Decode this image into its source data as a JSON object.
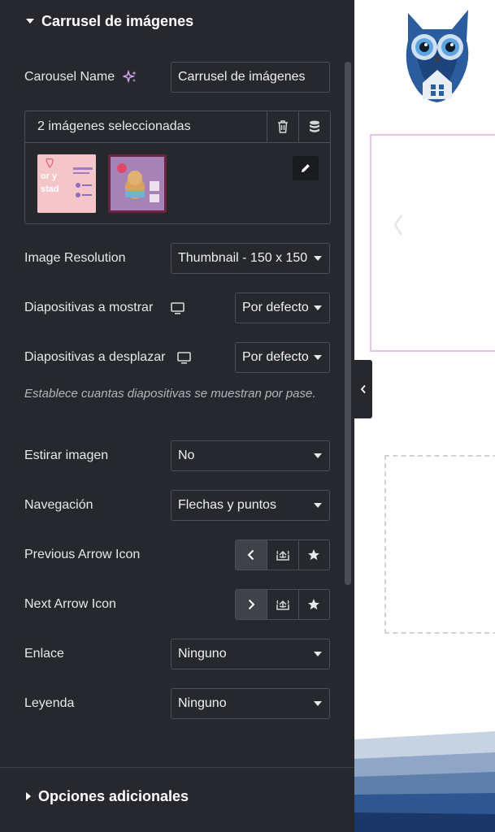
{
  "panel": {
    "section_title": "Carrusel de imágenes",
    "carousel_name": {
      "label": "Carousel Name",
      "value": "Carrusel de imágenes"
    },
    "gallery": {
      "count_text": "2 imágenes seleccionadas",
      "thumb1_text": "or y\nstad",
      "thumb2_text": ""
    },
    "image_resolution": {
      "label": "Image Resolution",
      "value": "Thumbnail - 150 x 150"
    },
    "slides_to_show": {
      "label": "Diapositivas a mostrar",
      "value": "Por defecto"
    },
    "slides_to_scroll": {
      "label": "Diapositivas a desplazar",
      "value": "Por defecto"
    },
    "help_text": "Establece cuantas diapositivas se muestran por pase.",
    "stretch_image": {
      "label": "Estirar imagen",
      "value": "No"
    },
    "navigation": {
      "label": "Navegación",
      "value": "Flechas y puntos"
    },
    "previous_arrow": {
      "label": "Previous Arrow Icon"
    },
    "next_arrow": {
      "label": "Next Arrow Icon"
    },
    "link": {
      "label": "Enlace",
      "value": "Ninguno"
    },
    "caption": {
      "label": "Leyenda",
      "value": "Ninguno"
    },
    "additional_options": "Opciones adicionales"
  },
  "colors": {
    "panel_bg": "#26282d",
    "border": "#4c4f55",
    "ai_accent": "#d9a9f7",
    "canvas_frame": "#e7c4ef",
    "owl_blue": "#2a5c9e"
  },
  "icons": [
    "ai-sparkle-icon",
    "trash-icon",
    "database-icon",
    "pencil-icon",
    "desktop-icon",
    "chevron-left-icon",
    "chevron-right-icon",
    "upload-icon",
    "star-icon",
    "collapse-chevron-icon",
    "owl-logo"
  ]
}
